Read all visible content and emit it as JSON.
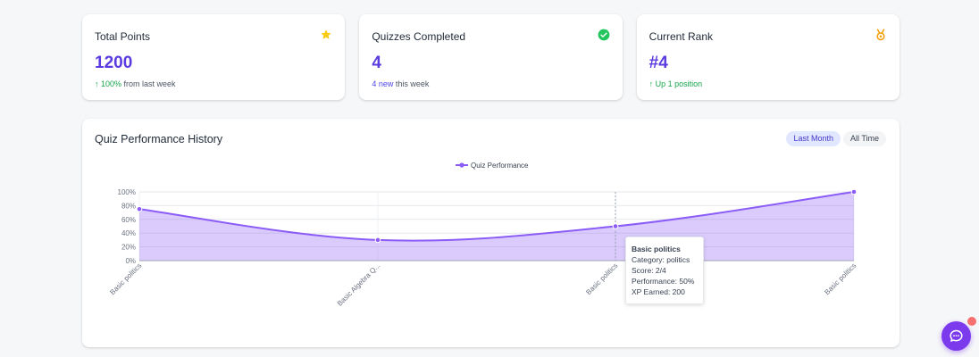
{
  "stats": {
    "total_points": {
      "title": "Total Points",
      "value": "1200",
      "change": "↑ 100%",
      "change_suffix": " from last week",
      "icon": "star-icon",
      "icon_color": "#facc15"
    },
    "quizzes": {
      "title": "Quizzes Completed",
      "value": "4",
      "change": "4 new",
      "change_suffix": " this week",
      "icon": "check-circle-icon",
      "icon_color": "#22c55e"
    },
    "rank": {
      "title": "Current Rank",
      "value": "#4",
      "change": "↑ Up 1 position",
      "change_suffix": "",
      "icon": "medal-icon",
      "icon_color": "#f59e0b"
    }
  },
  "performance": {
    "title": "Quiz Performance History",
    "tabs": {
      "last_month": "Last Month",
      "all_time": "All Time"
    }
  },
  "tooltip": {
    "title": "Basic politics",
    "category": "Category: politics",
    "score": "Score: 2/4",
    "performance": "Performance: 50%",
    "xp": "XP Earned: 200"
  },
  "chart_data": {
    "type": "area",
    "categories": [
      "Basic politics",
      "Basic Algebra Q...",
      "Basic politics",
      "Basic politics"
    ],
    "series": [
      {
        "name": "Quiz Performance",
        "values": [
          75,
          30,
          50,
          100
        ]
      }
    ],
    "ylim": [
      0,
      100
    ],
    "y_ticks": [
      "0%",
      "20%",
      "40%",
      "60%",
      "80%",
      "100%"
    ],
    "legend_position": "top-center",
    "grid": true,
    "color": "#8b5cf6"
  },
  "colors": {
    "accent": "#5b3be0",
    "positive": "#16a34a",
    "fab": "#7c3aed",
    "notification": "#f87171"
  }
}
